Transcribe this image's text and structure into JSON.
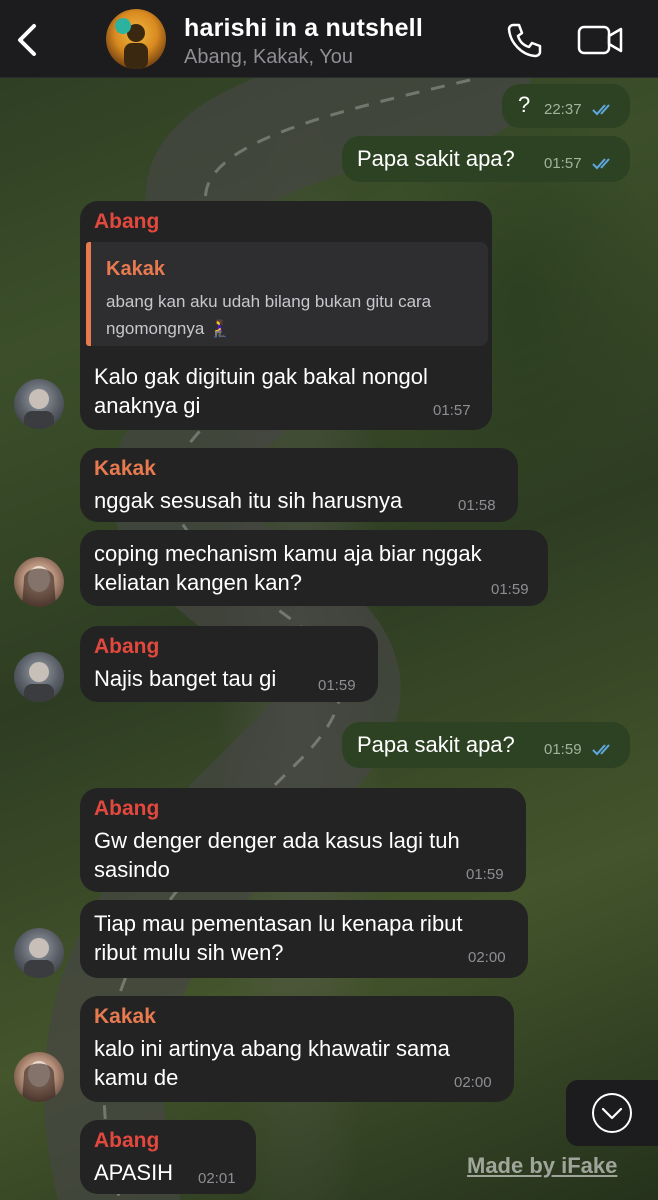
{
  "header": {
    "title": "harishi in a nutshell",
    "subtitle": "Abang, Kakak, You",
    "back_icon": "chevron-left-icon",
    "call_icon": "phone-icon",
    "video_icon": "video-camera-icon"
  },
  "colors": {
    "outgoing_bubble": "#2c4222",
    "incoming_bubble": "#232324",
    "abang_name": "#e2483d",
    "kakak_name": "#e87a50",
    "read_ticks": "#5fa8e0"
  },
  "messages": [
    {
      "text": "?",
      "time": "22:37"
    },
    {
      "text": "Papa sakit apa?",
      "time": "01:57"
    },
    {
      "sender": "Abang",
      "reply_to": {
        "name": "Kakak",
        "text": "abang kan aku udah bilang bukan gitu cara ngomongnya 🧎‍♀️"
      },
      "text": "Kalo gak digituin gak bakal nongol\nanaknya gi",
      "time": "01:57"
    },
    {
      "sender": "Kakak",
      "text": "nggak sesusah itu sih harusnya",
      "time": "01:58"
    },
    {
      "text": "coping mechanism kamu aja biar nggak\nkeliatan kangen kan?",
      "time": "01:59"
    },
    {
      "sender": "Abang",
      "text": "Najis banget tau gi",
      "time": "01:59"
    },
    {
      "text": "Papa sakit apa?",
      "time": "01:59"
    },
    {
      "sender": "Abang",
      "text": "Gw denger denger ada kasus lagi tuh\nsasindo",
      "time": "01:59"
    },
    {
      "text": "Tiap mau pementasan lu kenapa ribut\nribut mulu sih wen?",
      "time": "02:00"
    },
    {
      "sender": "Kakak",
      "text": "kalo ini artinya abang khawatir sama\nkamu de",
      "time": "02:00"
    },
    {
      "sender": "Abang",
      "text": "APASIH",
      "time": "02:01"
    }
  ],
  "scroll_icon": "chevron-down-circle-icon",
  "watermark": "Made by iFake"
}
